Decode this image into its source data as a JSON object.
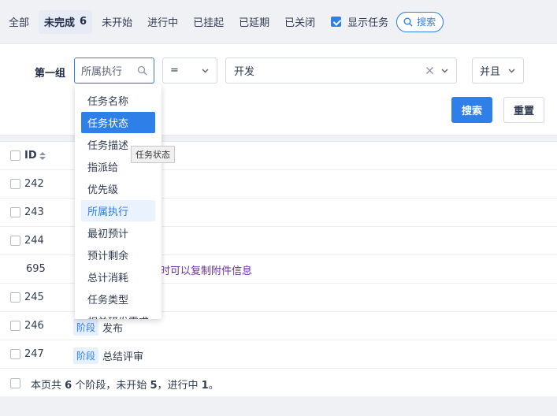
{
  "tabs": [
    {
      "label": "全部"
    },
    {
      "label": "未完成",
      "count": "6",
      "active": true
    },
    {
      "label": "未开始"
    },
    {
      "label": "进行中"
    },
    {
      "label": "已挂起"
    },
    {
      "label": "已延期"
    },
    {
      "label": "已关闭"
    }
  ],
  "show_tasks": {
    "label": "显示任务",
    "checked": true
  },
  "search_pill": {
    "label": "搜索"
  },
  "search_form": {
    "group_label": "第一组",
    "field": {
      "placeholder": "所属执行"
    },
    "operator": {
      "value": "="
    },
    "value": {
      "value": "开发"
    },
    "logic": {
      "value": "并且"
    },
    "search_button": "搜索",
    "reset_button": "重置"
  },
  "field_dropdown": {
    "items": [
      "任务名称",
      "任务状态",
      "任务描述",
      "指派给",
      "优先级",
      "所属执行",
      "最初预计",
      "预计剩余",
      "总计消耗",
      "任务类型",
      "相关研发需求"
    ],
    "hovered": "任务状态",
    "selected": "所属执行",
    "tooltip": "任务状态"
  },
  "table": {
    "header_id": "ID",
    "rows": [
      {
        "id": "242",
        "checkbox": true,
        "tag": "",
        "title": ""
      },
      {
        "id": "243",
        "checkbox": true,
        "tag": "",
        "title": ""
      },
      {
        "id": "244",
        "checkbox": true,
        "tag": "",
        "title": ""
      },
      {
        "id": "695",
        "checkbox": false,
        "tag": "",
        "title": "时可以复制附件信息",
        "link": true
      },
      {
        "id": "245",
        "checkbox": true,
        "tag": "",
        "title": ""
      },
      {
        "id": "246",
        "checkbox": true,
        "tag": "阶段",
        "title": "发布"
      },
      {
        "id": "247",
        "checkbox": true,
        "tag": "阶段",
        "title": "总结评审"
      }
    ],
    "summary": {
      "p1": "本页共 ",
      "n1": "6",
      "p2": " 个阶段，未开始 ",
      "n2": "5",
      "p3": "，进行中 ",
      "n3": "1",
      "p4": "。"
    }
  },
  "colors": {
    "accent": "#2e7fe8",
    "link": "#6a2fa8",
    "tag_bg": "#e7f0fd"
  }
}
